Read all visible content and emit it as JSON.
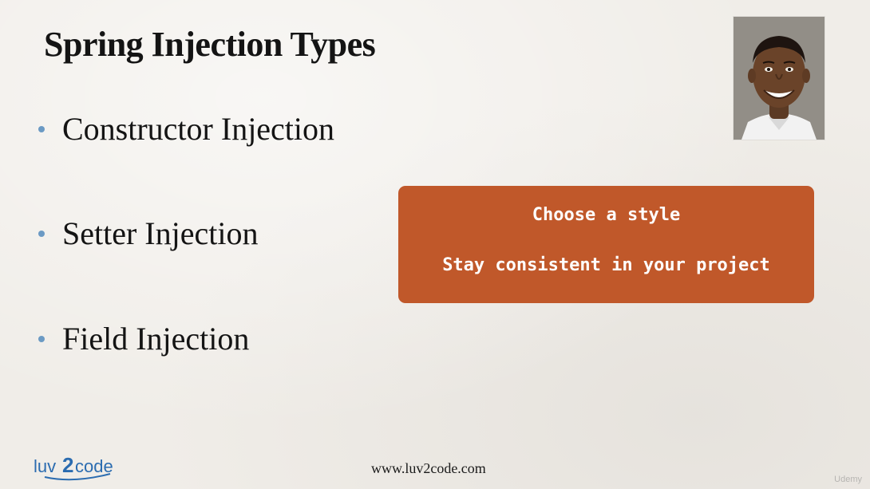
{
  "slide": {
    "title": "Spring Injection Types",
    "bullets": [
      {
        "text": "Constructor Injection"
      },
      {
        "text": "Setter Injection"
      },
      {
        "text": "Field Injection"
      }
    ],
    "callout": {
      "line1": "Choose a style",
      "line2": "Stay consistent in your project"
    },
    "footer": {
      "url": "www.luv2code.com"
    },
    "logo": {
      "text": "luv2code"
    },
    "watermark": "Udemy"
  },
  "colors": {
    "background": "#f0ede8",
    "bullet": "#6b9ac4",
    "callout_bg": "#c0582a",
    "logo_blue": "#2b6cb0"
  },
  "icons": {
    "photo": "presenter-photo",
    "logo": "luv2code-logo"
  }
}
